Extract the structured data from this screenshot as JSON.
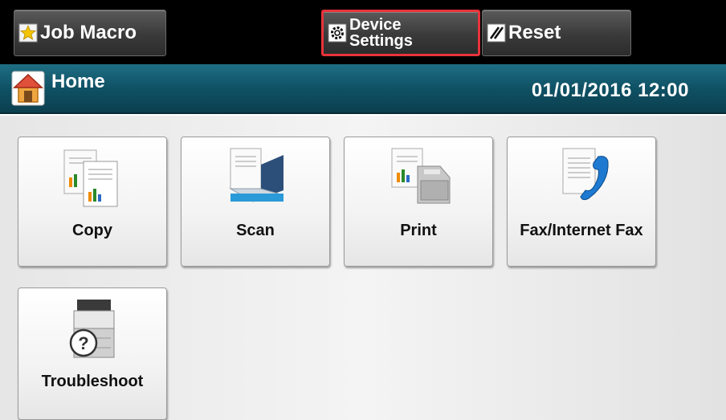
{
  "toolbar": {
    "job_macro_label": "Job Macro",
    "device_settings_label_line1": "Device",
    "device_settings_label_line2": "Settings",
    "reset_label": "Reset"
  },
  "header": {
    "title": "Home",
    "datetime": "01/01/2016 12:00"
  },
  "tiles": [
    {
      "label": "Copy",
      "icon": "copy-icon"
    },
    {
      "label": "Scan",
      "icon": "scan-icon"
    },
    {
      "label": "Print",
      "icon": "print-icon"
    },
    {
      "label": "Fax/Internet Fax",
      "icon": "fax-icon"
    },
    {
      "label": "Troubleshoot",
      "icon": "troubleshoot-icon"
    }
  ],
  "colors": {
    "topbar": "#000000",
    "titlebar": "#0f5164",
    "highlight": "#e8333a"
  }
}
